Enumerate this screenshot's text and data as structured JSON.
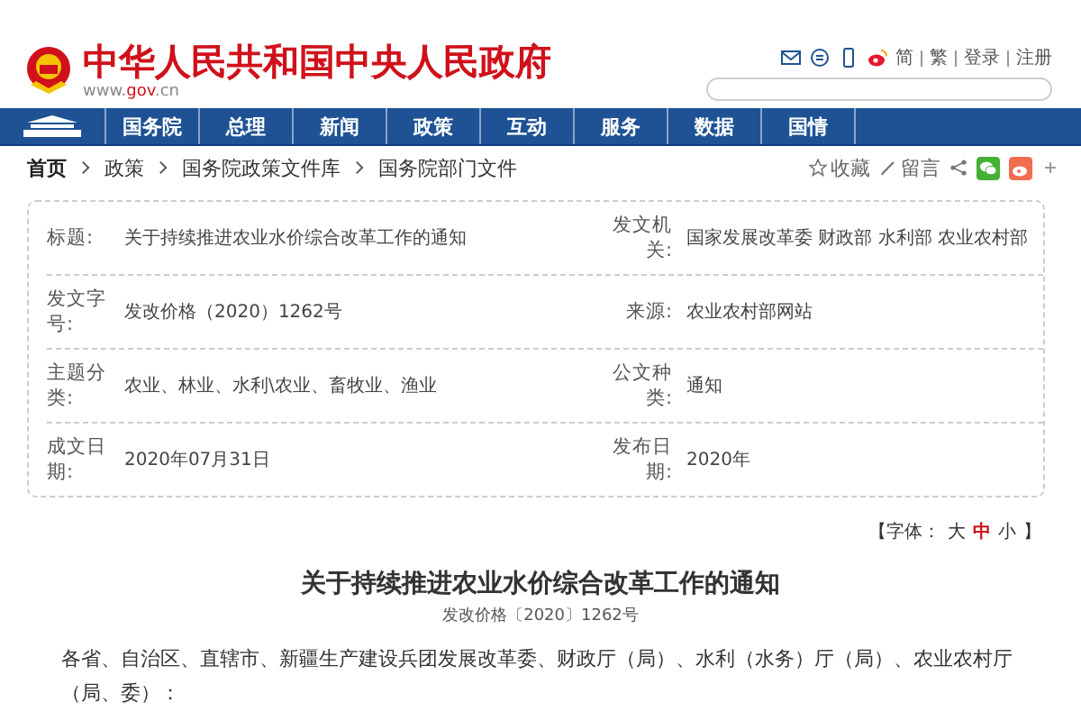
{
  "site": {
    "title": "中华人民共和国中央人民政府",
    "url_parts": [
      "www.",
      "gov",
      ".cn"
    ]
  },
  "top_links": [
    "简",
    "繁",
    "登录",
    "注册"
  ],
  "nav": [
    {
      "label": "国务院",
      "selected": false
    },
    {
      "label": "总理",
      "selected": false
    },
    {
      "label": "新闻",
      "selected": false
    },
    {
      "label": "政策",
      "selected": false
    },
    {
      "label": "互动",
      "selected": false
    },
    {
      "label": "服务",
      "selected": false
    },
    {
      "label": "数据",
      "selected": false
    },
    {
      "label": "国情",
      "selected": false
    }
  ],
  "breadcrumb": [
    "首页",
    "政策",
    "国务院政策文件库",
    "国务院部门文件"
  ],
  "actions": {
    "favorite": "收藏",
    "comment": "留言"
  },
  "info_rows": [
    {
      "label": "标题:",
      "value": "关于持续推进农业水价综合改革工作的通知",
      "label2": "发文机关:",
      "value2": "国家发展改革委 财政部 水利部 农业农村部"
    },
    {
      "label": "发文字号:",
      "value": "发改价格（2020）1262号",
      "label2": "来源:",
      "value2": "农业农村部网站"
    },
    {
      "label": "主题分类:",
      "value": "农业、林业、水利\\农业、畜牧业、渔业",
      "label2": "公文种类:",
      "value2": "通知"
    },
    {
      "label": "成文日期:",
      "value": "2020年07月31日",
      "label2": "发布日期:",
      "value2": "2020年"
    }
  ],
  "font_size": {
    "prefix": "【字体：",
    "options": [
      {
        "label": "大",
        "selected": false
      },
      {
        "label": "中",
        "selected": true
      },
      {
        "label": "小",
        "selected": false
      }
    ],
    "suffix": "】"
  },
  "article": {
    "title": "关于持续推进农业水价综合改革工作的通知",
    "doc_number": "发改价格〔2020〕1262号",
    "body": "各省、自治区、直辖市、新疆生产建设兵团发展改革委、财政厅（局）、水利（水务）厅（局）、农业农村厅（局、委）："
  }
}
